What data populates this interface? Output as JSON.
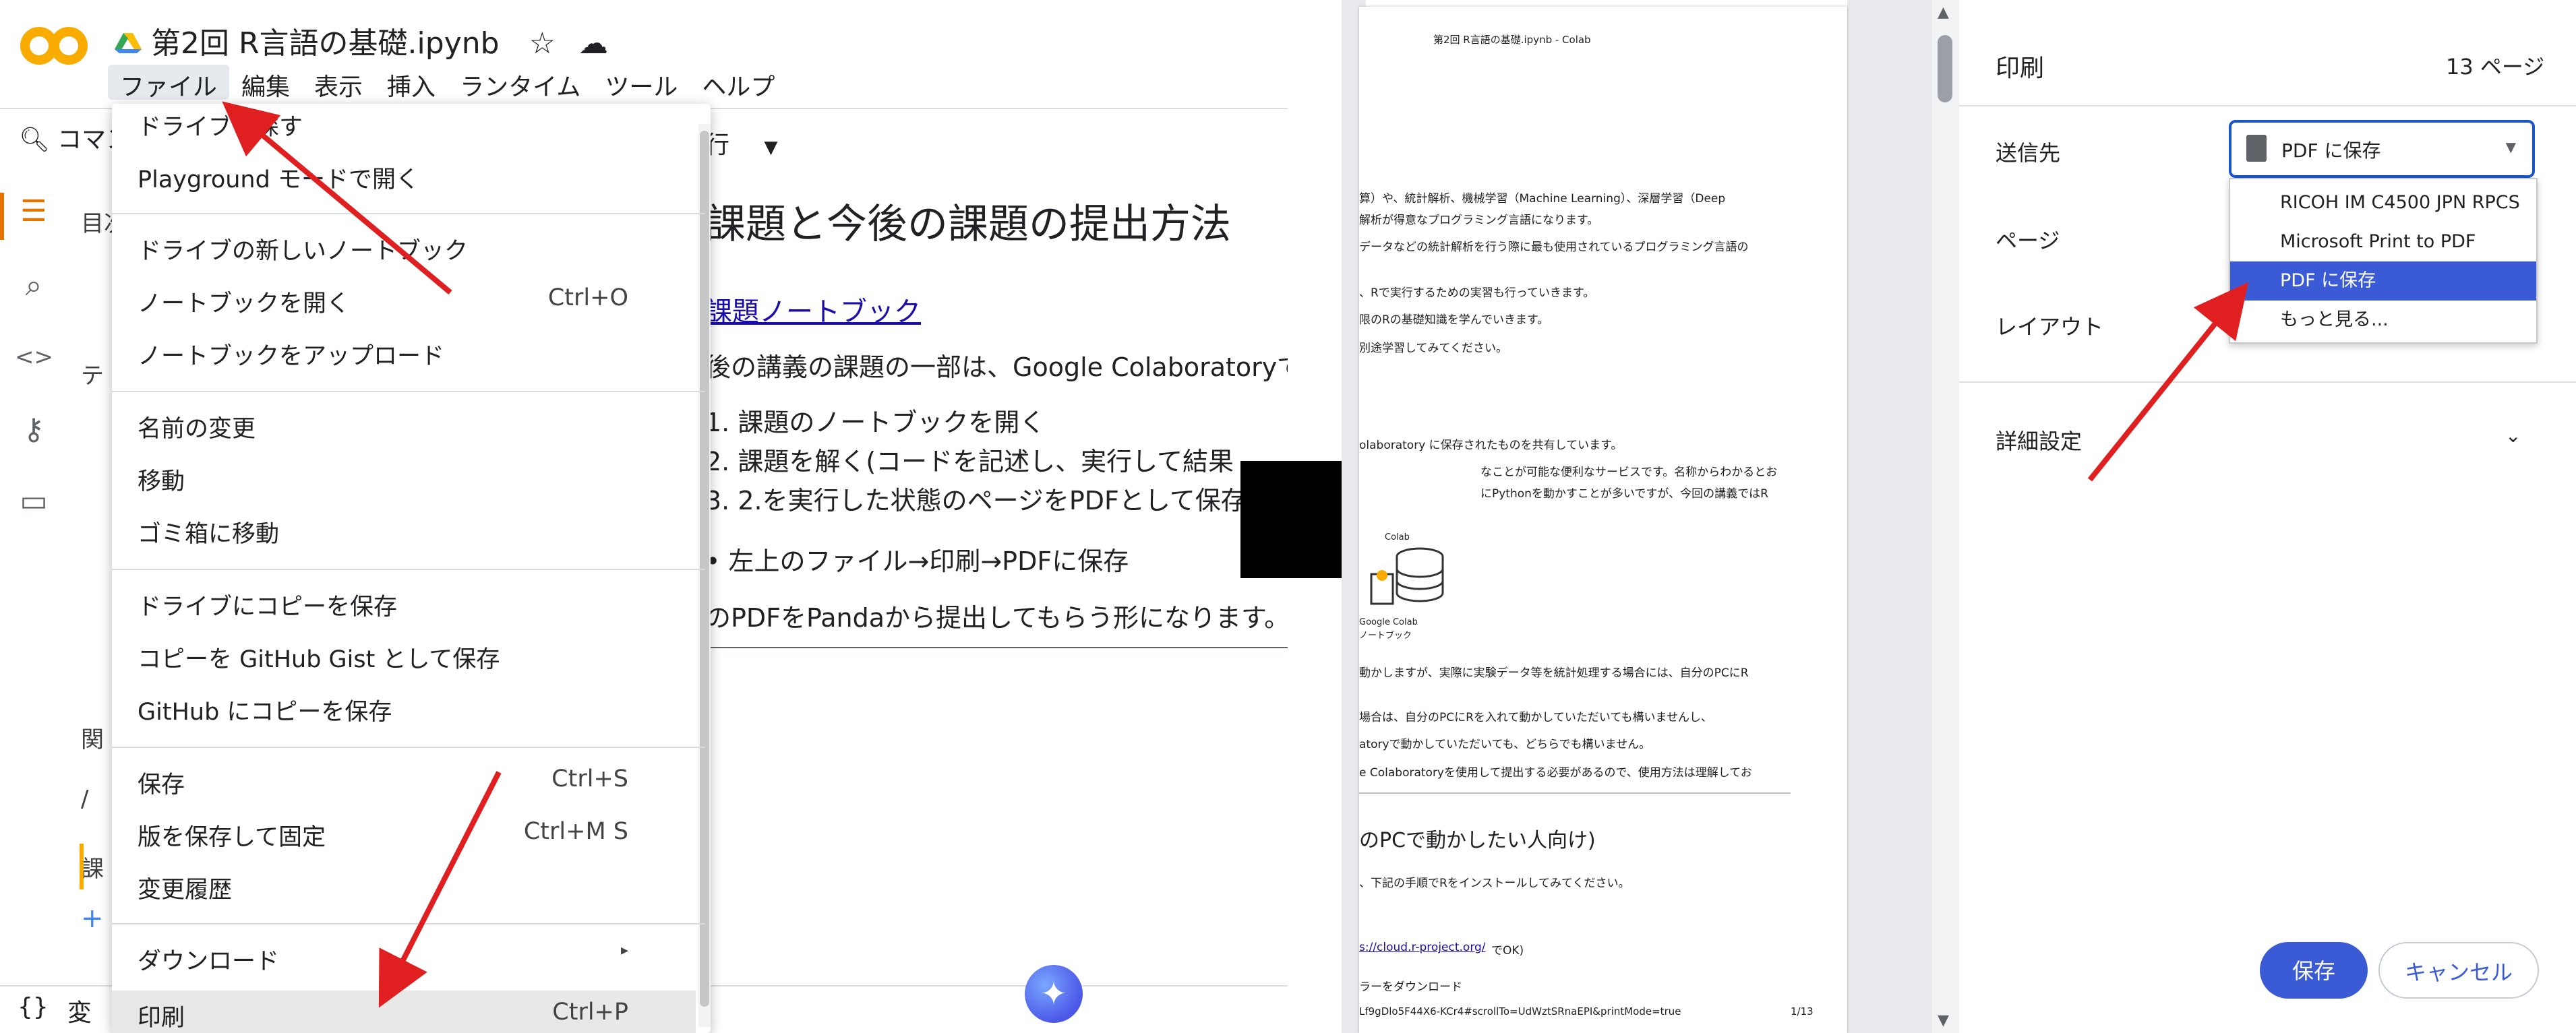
{
  "colab": {
    "title": "第2回 R言語の基礎.ipynb",
    "menu": [
      "ファイル",
      "編集",
      "表示",
      "挿入",
      "ランタイム",
      "ツール",
      "ヘルプ"
    ],
    "command_search": "コマン",
    "run_partial": "行",
    "toc_label": "目次",
    "toc_items": [
      "テ",
      "関",
      "/",
      "課"
    ],
    "variables_label": "変",
    "doc_heading": "課題と今後の課題の提出方法",
    "doc_link": "課題ノートブック",
    "doc_intro": "後の講義の課題の一部は、Google Colaboratoryで",
    "doc_steps": [
      "1. 課題のノートブックを開く",
      "2. 課題を解く(コードを記述し、実行して結果",
      "3. 2.を実行した状態のページをPDFとして保存"
    ],
    "doc_bullet": "• 左上のファイル→印刷→PDFに保存",
    "doc_closing": "のPDFをPandaから提出してもらう形になります。"
  },
  "file_menu": {
    "items": [
      {
        "label": "ドライブで探す",
        "shortcut": ""
      },
      {
        "label": "Playground モードで開く",
        "shortcut": ""
      },
      {
        "label": "ドライブの新しいノートブック",
        "shortcut": ""
      },
      {
        "label": "ノートブックを開く",
        "shortcut": "Ctrl+O"
      },
      {
        "label": "ノートブックをアップロード",
        "shortcut": ""
      },
      {
        "label": "名前の変更",
        "shortcut": ""
      },
      {
        "label": "移動",
        "shortcut": ""
      },
      {
        "label": "ゴミ箱に移動",
        "shortcut": ""
      },
      {
        "label": "ドライブにコピーを保存",
        "shortcut": ""
      },
      {
        "label": "コピーを GitHub Gist として保存",
        "shortcut": ""
      },
      {
        "label": "GitHub にコピーを保存",
        "shortcut": ""
      },
      {
        "label": "保存",
        "shortcut": "Ctrl+S"
      },
      {
        "label": "版を保存して固定",
        "shortcut": "Ctrl+M S"
      },
      {
        "label": "変更履歴",
        "shortcut": ""
      },
      {
        "label": "ダウンロード",
        "shortcut": "▸"
      },
      {
        "label": "印刷",
        "shortcut": "Ctrl+P"
      }
    ]
  },
  "preview": {
    "header": "第2回 R言語の基礎.ipynb - Colab",
    "lines": [
      "算）や、統計解析、機械学習（Machine Learning）、深層学習（Deep",
      "解析が得意なプログラミング言語になります。",
      "データなどの統計解析を行う際に最も使用されているプログラミング言語の",
      "、Rで実行するための実習も行っていきます。",
      "限のRの基礎知識を学んでいきます。",
      "別途学習してみてください。",
      "olaboratory に保存されたものを共有しています。",
      "なことが可能な便利なサービスです。名称からわかるとお",
      "にPythonを動かすことが多いですが、今回の講義ではR",
      "Colab",
      "Google Colab",
      "ノートブック",
      "動かしますが、実際に実験データ等を統計処理する場合には、自分のPCにR",
      "場合は、自分のPCにRを入れて動かしていただいても構いませんし、",
      "atoryで動かしていただいても、どちらでも構いません。",
      "e Colaboratoryを使用して提出する必要があるので、使用方法は理解してお",
      "、下記の手順でRをインストールしてみてください。",
      "s://cloud.r-project.org/",
      "でOK)",
      "ラーをダウンロード",
      "Lf9gDlo5F44X6-KCr4#scrollTo=UdWztSRnaEPI&printMode=true",
      "1/13"
    ],
    "heading": "のPCで動かしたい人向け)"
  },
  "print_settings": {
    "title": "印刷",
    "page_count": "13 ページ",
    "destination_label": "送信先",
    "destination_value": "PDF に保存",
    "pages_label": "ページ",
    "layout_label": "レイアウト",
    "more_settings_label": "詳細設定",
    "dropdown_options": [
      "RICOH IM C4500 JPN RPCS",
      "Microsoft Print to PDF",
      "PDF に保存",
      "もっと見る..."
    ],
    "save_button": "保存",
    "cancel_button": "キャンセル"
  },
  "colors": {
    "annotation_arrow": "#e02020",
    "accent_blue": "#3b5bd6",
    "colab_orange": "#f9ab00"
  }
}
